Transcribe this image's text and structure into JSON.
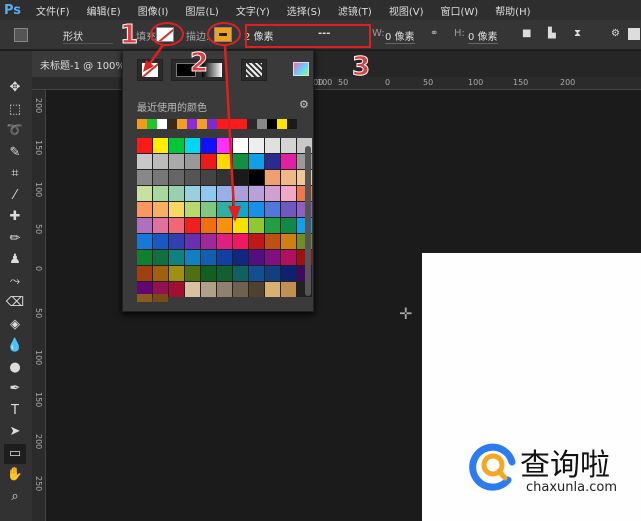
{
  "app": {
    "logo": "Ps"
  },
  "menu": [
    "文件(F)",
    "编辑(E)",
    "图像(I)",
    "图层(L)",
    "文字(Y)",
    "选择(S)",
    "滤镜(T)",
    "视图(V)",
    "窗口(W)",
    "帮助(H)"
  ],
  "options": {
    "mode": "形状",
    "fill_label": "填充:",
    "stroke_label": "描边:",
    "stroke_width": "2 像素",
    "stroke_style": "---",
    "w_label": "W:",
    "w_value": "0 像素",
    "h_label": "H:",
    "h_value": "0 像素"
  },
  "document": {
    "tab": "未标题-1 @ 100%"
  },
  "ruler_top": [
    "400",
    "100",
    "50",
    "0",
    "50",
    "100",
    "150",
    "200"
  ],
  "ruler_left": [
    "200",
    "150",
    "100",
    "50",
    "0",
    "50",
    "100",
    "150",
    "200",
    "250"
  ],
  "popup": {
    "recent_label": "最近使用的颜色",
    "recent": [
      "#f39a1b",
      "#22c42c",
      "#ffffff",
      "#3a2a1a",
      "#f4a01e",
      "#8a2be2",
      "#f4a01e",
      "#7a2bd2",
      "#ff1a1a",
      "#ff1a1a",
      "#ff1a1a",
      "#2a2a2a",
      "#888888",
      "#000000",
      "#ffe400",
      "#1a1a1a"
    ],
    "swatches": [
      "#ff1a1a",
      "#ffee00",
      "#00c83a",
      "#00d8f0",
      "#1010ff",
      "#ff30ff",
      "#ffffff",
      "#eeeeee",
      "#e0e0e0",
      "#d4d4d4",
      "#c8c8c8",
      "#c8c8c8",
      "#bbbbbb",
      "#aaaaaa",
      "#999999",
      "#ee1a1a",
      "#ffd800",
      "#109040",
      "#10a0e8",
      "#2a2a90",
      "#e020a0",
      "#999999",
      "#888888",
      "#777777",
      "#666666",
      "#555555",
      "#444444",
      "#333333",
      "#1a1a1a",
      "#000000",
      "#f0a070",
      "#f0b888",
      "#f0c898",
      "#c8e0a0",
      "#a8d8a0",
      "#98d0b0",
      "#98d0e0",
      "#90c8f0",
      "#98b0e8",
      "#a8a0d8",
      "#b8a0d8",
      "#d0a0d0",
      "#f0a8c8",
      "#f07848",
      "#f89860",
      "#f8b060",
      "#f8d860",
      "#b8d870",
      "#80c880",
      "#30b0a0",
      "#10a8c8",
      "#1890e8",
      "#5078d8",
      "#7058c0",
      "#9060c0",
      "#b070c0",
      "#e070a0",
      "#f06878",
      "#f02020",
      "#f07010",
      "#f89010",
      "#f8e000",
      "#90c830",
      "#20a040",
      "#108848",
      "#10a0f0",
      "#1878d8",
      "#1858c0",
      "#3040b0",
      "#6830b0",
      "#a02898",
      "#e02080",
      "#f01860",
      "#c01818",
      "#c05010",
      "#d08010",
      "#709020",
      "#108030",
      "#107040",
      "#108080",
      "#1080c0",
      "#1060b0",
      "#1040a0",
      "#102880",
      "#501080",
      "#801080",
      "#b01060",
      "#a01010",
      "#a04010",
      "#a06010",
      "#a09010",
      "#507010",
      "#106020",
      "#106030",
      "#106060",
      "#105090",
      "#104080",
      "#102070",
      "#400860",
      "#600870",
      "#901050",
      "#a01030",
      "#d8c0a0",
      "#b0a088",
      "#908070",
      "#706050",
      "#504030",
      "#d8b070",
      "#c09050"
    ],
    "extra": [
      "#8a5a20",
      "#7a4a18"
    ]
  },
  "annotations": {
    "n1": "1",
    "n2": "2",
    "n3": "3"
  },
  "watermark": {
    "brand": "查询啦",
    "domain": "chaxunla.com"
  }
}
